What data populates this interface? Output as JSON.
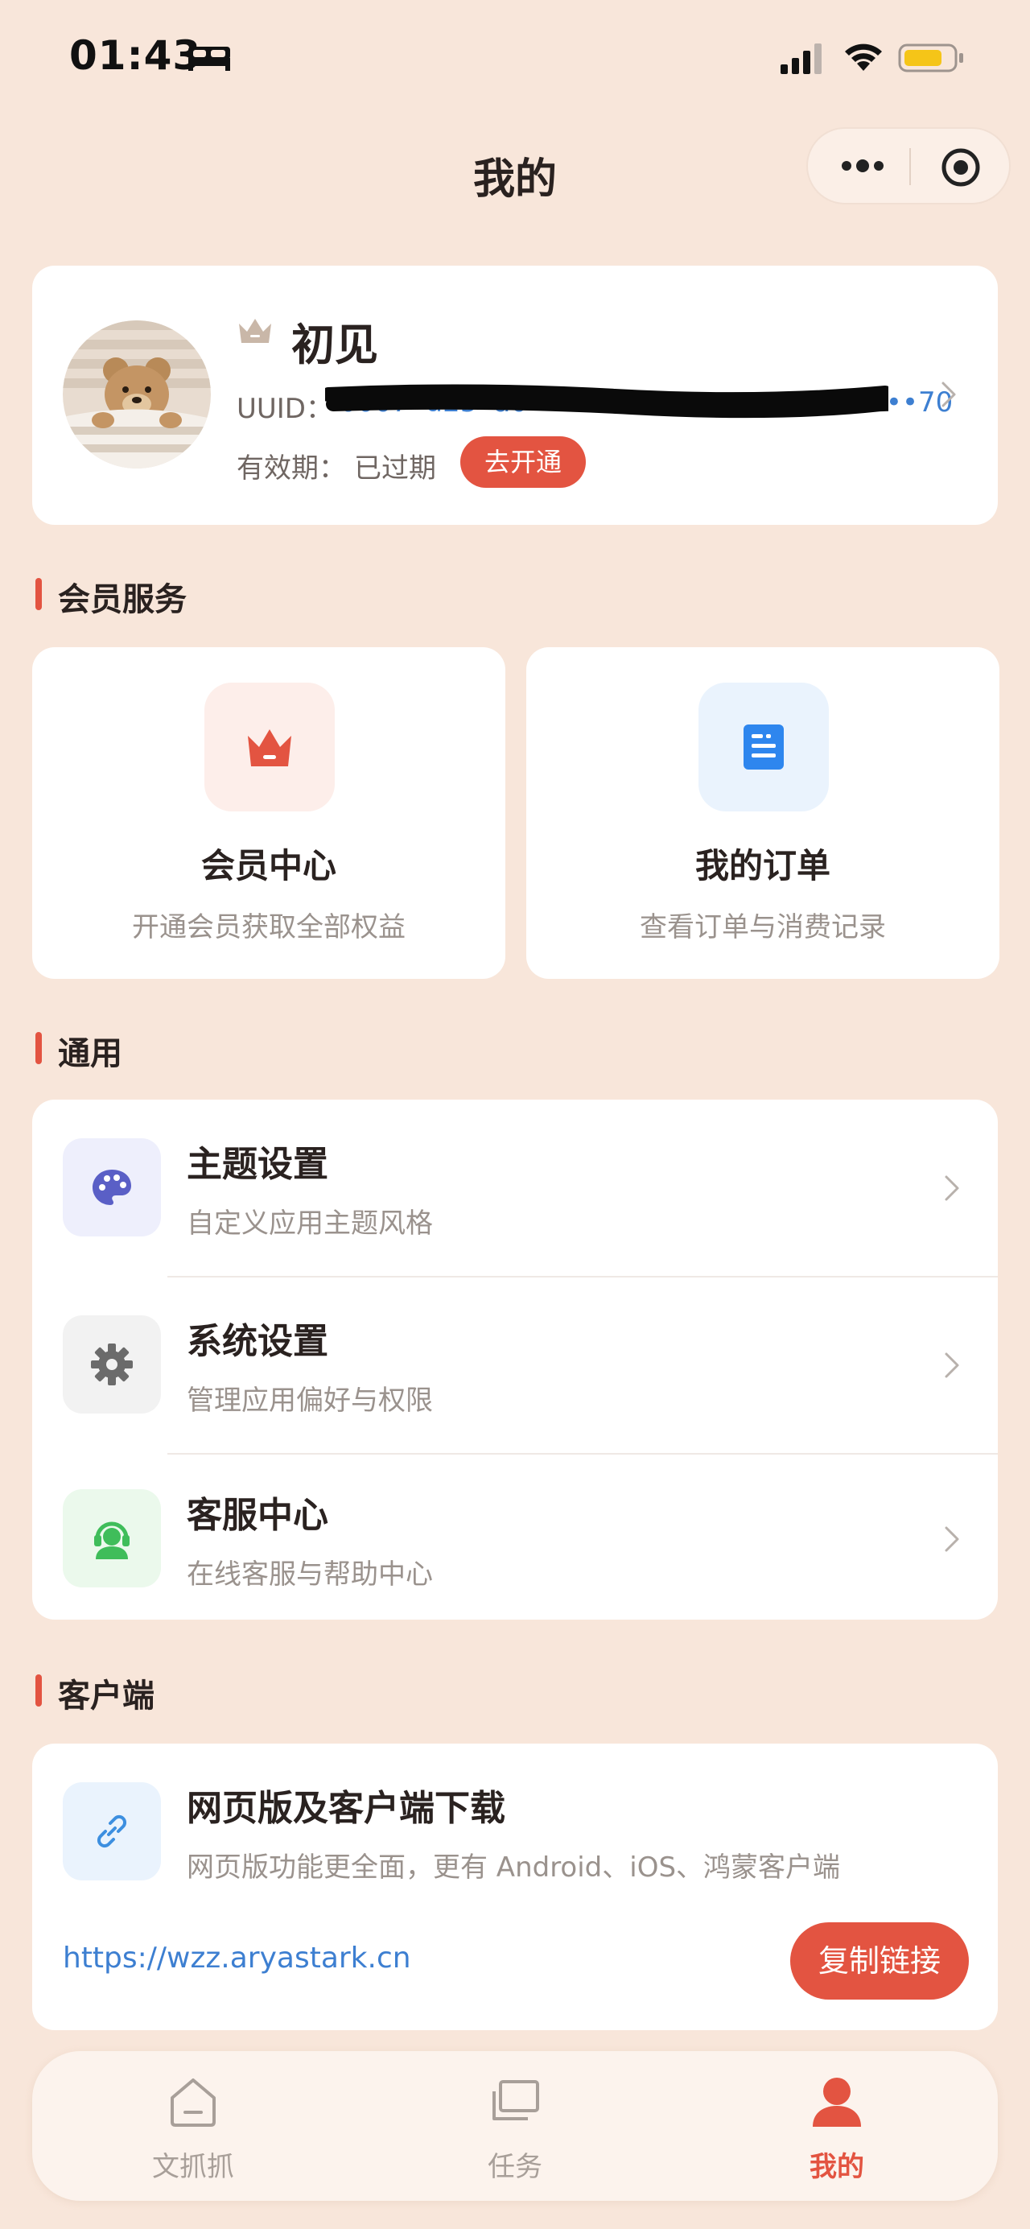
{
  "status_bar": {
    "time": "01:43",
    "icons": [
      "bed-icon",
      "signal-icon",
      "wifi-icon",
      "battery-icon"
    ]
  },
  "nav": {
    "title": "我的",
    "capsule_icons": [
      "more-dots-icon",
      "target-icon"
    ]
  },
  "profile": {
    "nickname": "初见",
    "uuid_label": "UUID：",
    "uuid_value": "f0007•d25•a0••1fe5b••••••••••0011•••70",
    "expiry_label": "有效期：",
    "expiry_status": "已过期",
    "activate_label": "去开通"
  },
  "member_section": {
    "title": "会员服务",
    "tiles": [
      {
        "title": "会员中心",
        "subtitle": "开通会员获取全部权益",
        "icon": "crown-icon",
        "icon_color": "#e35441",
        "bg": "#fdeeea"
      },
      {
        "title": "我的订单",
        "subtitle": "查看订单与消费记录",
        "icon": "document-icon",
        "icon_color": "#2e86ee",
        "bg": "#eaf3fd"
      }
    ]
  },
  "general_section": {
    "title": "通用",
    "items": [
      {
        "title": "主题设置",
        "subtitle": "自定义应用主题风格",
        "icon": "palette-icon",
        "icon_color": "#5a5fc6",
        "bg": "#eeeffc"
      },
      {
        "title": "系统设置",
        "subtitle": "管理应用偏好与权限",
        "icon": "gear-icon",
        "icon_color": "#6b6b6b",
        "bg": "#f2f2f2"
      },
      {
        "title": "客服中心",
        "subtitle": "在线客服与帮助中心",
        "icon": "headset-icon",
        "icon_color": "#3fbd5a",
        "bg": "#ebf9ec"
      }
    ]
  },
  "client_section": {
    "title": "客户端",
    "item_title": "网页版及客户端下载",
    "item_subtitle": "网页版功能更全面，更有 Android、iOS、鸿蒙客户端",
    "icon": "link-icon",
    "url": "https://wzz.aryastark.cn",
    "copy_label": "复制链接"
  },
  "tabbar": {
    "tabs": [
      {
        "label": "文抓抓",
        "icon": "home-icon",
        "active": false
      },
      {
        "label": "任务",
        "icon": "stack-icon",
        "active": false
      },
      {
        "label": "我的",
        "icon": "person-icon",
        "active": true
      }
    ],
    "active_color": "#e35441"
  }
}
